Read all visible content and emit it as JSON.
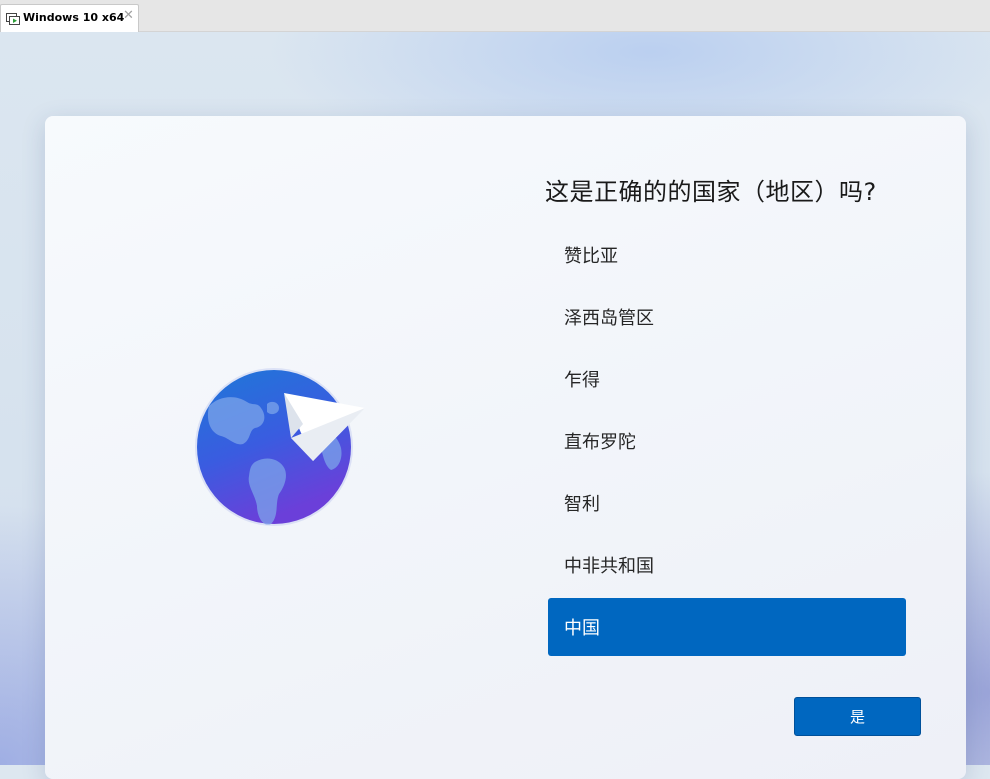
{
  "window": {
    "tab_title": "Windows 10 x64",
    "close_glyph": "✕"
  },
  "oobe": {
    "question": "这是正确的的国家（地区）吗?",
    "illustration": "globe-paper-plane-icon",
    "regions": [
      {
        "label": "赞比亚",
        "selected": false
      },
      {
        "label": "泽西岛管区",
        "selected": false
      },
      {
        "label": "乍得",
        "selected": false
      },
      {
        "label": "直布罗陀",
        "selected": false
      },
      {
        "label": "智利",
        "selected": false
      },
      {
        "label": "中非共和国",
        "selected": false
      },
      {
        "label": "中国",
        "selected": true
      }
    ],
    "yes_button": "是"
  },
  "colors": {
    "accent": "#0067c0",
    "globe_top": "#1f73d6",
    "globe_bottom": "#6a3fd8"
  }
}
